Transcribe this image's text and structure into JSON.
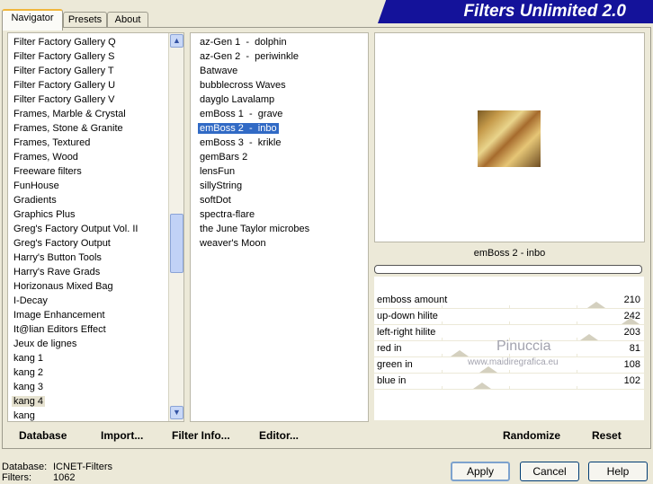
{
  "banner": {
    "title": "Filters Unlimited 2.0"
  },
  "tabs": [
    {
      "label": "Navigator",
      "active": true
    },
    {
      "label": "Presets",
      "active": false
    },
    {
      "label": "About",
      "active": false
    }
  ],
  "categories": [
    "Filter Factory Gallery Q",
    "Filter Factory Gallery S",
    "Filter Factory Gallery T",
    "Filter Factory Gallery U",
    "Filter Factory Gallery V",
    "Frames, Marble & Crystal",
    "Frames, Stone & Granite",
    "Frames, Textured",
    "Frames, Wood",
    "Freeware filters",
    "FunHouse",
    "Gradients",
    "Graphics Plus",
    "Greg's Factory Output Vol. II",
    "Greg's Factory Output",
    "Harry's Button Tools",
    "Harry's Rave Grads",
    "Horizonaus Mixed Bag",
    "I-Decay",
    "Image Enhancement",
    "It@lian Editors Effect",
    "Jeux de lignes",
    "kang 1",
    "kang 2",
    "kang 3",
    "kang 4",
    "kang"
  ],
  "selected_category": "kang 4",
  "filters": [
    "az-Gen 1  -  dolphin",
    "az-Gen 2  -  periwinkle",
    "Batwave",
    "bubblecross Waves",
    "dayglo Lavalamp",
    "emBoss 1  -  grave",
    "emBoss 2  -  inbo",
    "emBoss 3  -  krikle",
    "gemBars 2",
    "lensFun",
    "sillyString",
    "softDot",
    "spectra-flare",
    "the June Taylor microbes",
    "weaver's Moon"
  ],
  "selected_filter": "emBoss 2  -  inbo",
  "preview": {
    "filter_name": "emBoss 2  -  inbo"
  },
  "sliders": [
    {
      "label": "emboss amount",
      "value": "210",
      "level": 0.824
    },
    {
      "label": "up-down hilite",
      "value": "242",
      "level": 0.949
    },
    {
      "label": "left-right hilite",
      "value": "203",
      "level": 0.796
    },
    {
      "label": "red in",
      "value": "81",
      "level": 0.318
    },
    {
      "label": "green in",
      "value": "108",
      "level": 0.424
    },
    {
      "label": "blue in",
      "value": "102",
      "level": 0.4
    }
  ],
  "toolbar": {
    "database": "Database",
    "import": "Import...",
    "filter_info": "Filter Info...",
    "editor": "Editor...",
    "randomize": "Randomize",
    "reset": "Reset"
  },
  "watermark": {
    "line1": "Pinuccia",
    "line2": "www.maidiregrafica.eu"
  },
  "status": {
    "database_label": "Database:",
    "database_value": "ICNET-Filters",
    "filters_label": "Filters:",
    "filters_value": "1062"
  },
  "buttons": {
    "apply": "Apply",
    "cancel": "Cancel",
    "help": "Help"
  }
}
